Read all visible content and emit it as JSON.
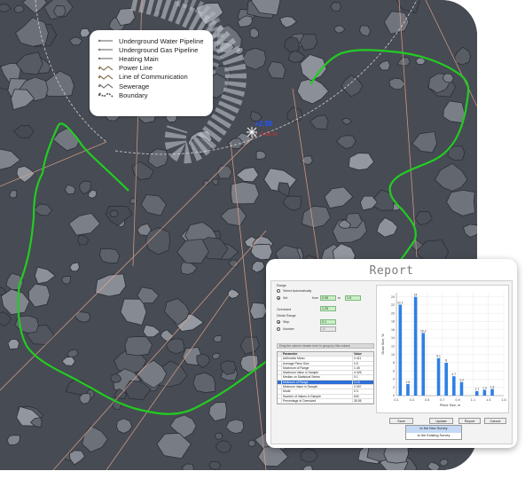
{
  "legend": {
    "items": [
      {
        "label": "Underground Water Pipeline",
        "icon": "water-pipeline-icon"
      },
      {
        "label": "Underground Gas Pipeline",
        "icon": "gas-pipeline-icon"
      },
      {
        "label": "Heating Main",
        "icon": "heating-main-icon"
      },
      {
        "label": "Power Line",
        "icon": "power-line-icon"
      },
      {
        "label": "Line of Communication",
        "icon": "communication-line-icon"
      },
      {
        "label": "Sewerage",
        "icon": "sewerage-icon"
      },
      {
        "label": "Boundary",
        "icon": "boundary-icon"
      }
    ]
  },
  "map": {
    "marker_label": "+2.98",
    "marker_sub": "-0.16 m",
    "boundary_color": "#22cc22"
  },
  "report": {
    "title": "Report",
    "range_label": "Range",
    "select_auto": "Select Automatically",
    "set_label": "Set",
    "from_label": "from",
    "from_value": "0.05",
    "to_label": "to",
    "to_value": "1.9",
    "oversized_label": "Oversized",
    "oversized_value": "1.25",
    "divide_label": "Divide Range",
    "step_label": "Step",
    "step_value": "0.1",
    "number_label": "Number",
    "number_value": "10",
    "group_hint": "Drag the column header here to group by this column",
    "table_header": {
      "param": "Parameter",
      "value": "Value"
    },
    "rows": [
      {
        "param": "Arithmetic Mean",
        "value": "0.411"
      },
      {
        "param": "Average Piece Size",
        "value": "0.5"
      },
      {
        "param": "Maximum of Range",
        "value": "1.45"
      },
      {
        "param": "Maximum Value in Sample",
        "value": "4.426"
      },
      {
        "param": "Median on Statistical Series",
        "value": "0.1"
      },
      {
        "param": "Minimum of Range",
        "value": "0.15"
      },
      {
        "param": "Minimum Value in Sample",
        "value": "0.097"
      },
      {
        "param": "Mode",
        "value": "0.3"
      },
      {
        "param": "Number of Values in Sample",
        "value": "634"
      },
      {
        "param": "Percentage of Oversized",
        "value": "35.55"
      }
    ],
    "selected_row": 5,
    "buttons": {
      "save": "Save",
      "update": "Update",
      "report": "Report",
      "cancel": "Cancel"
    },
    "save_menu": [
      "to the New Survey",
      "to the Existing Survey"
    ]
  },
  "chart_data": {
    "type": "bar",
    "xlabel": "Piece Size, m",
    "ylabel": "Grain Size, %",
    "ylim": [
      0,
      25
    ],
    "yticks": [
      0,
      2,
      4,
      6,
      8,
      10,
      12,
      14,
      16,
      18,
      20,
      22,
      24
    ],
    "xticks": [
      "0.1",
      "0.3",
      "0.5",
      "0.7",
      "0.9",
      "1.1",
      "1.3",
      "1.5"
    ],
    "x": [
      0.15,
      0.25,
      0.35,
      0.45,
      0.55,
      0.65,
      0.75,
      0.85,
      0.95,
      1.05,
      1.15,
      1.25,
      1.35
    ],
    "values": [
      22.1,
      2.8,
      24,
      15.2,
      0,
      9.1,
      8,
      4.7,
      3.3,
      0,
      1.1,
      1.4,
      1.6
    ],
    "labels": [
      "22.1",
      "2.8",
      "24",
      "15.2",
      "",
      "9.1",
      "8",
      "4.7",
      "3.3",
      "",
      "1.1",
      "1.4",
      "1.6"
    ],
    "bar_color": "#2f7fe6",
    "grid": true
  }
}
